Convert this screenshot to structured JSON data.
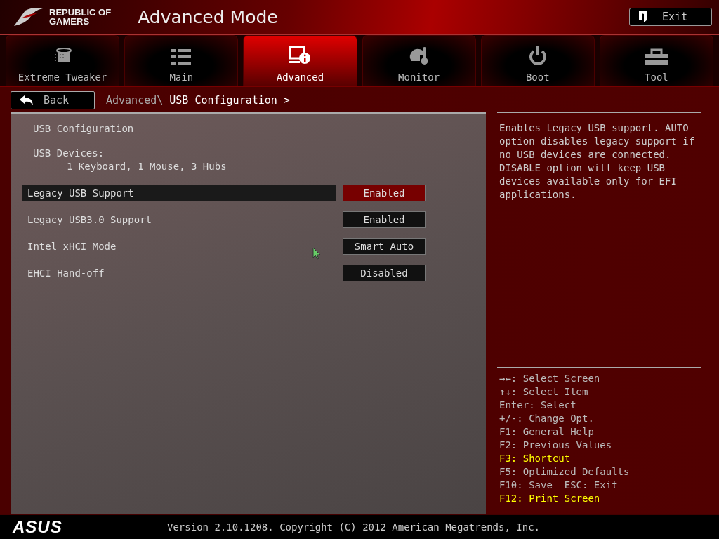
{
  "header": {
    "brand_line_1": "REPUBLIC OF",
    "brand_line_2": "GAMERS",
    "title": "Advanced Mode",
    "exit_button": "Exit"
  },
  "tabs": [
    {
      "label": "Extreme Tweaker",
      "selected": false
    },
    {
      "label": "Main",
      "selected": false
    },
    {
      "label": "Advanced",
      "selected": true
    },
    {
      "label": "Monitor",
      "selected": false
    },
    {
      "label": "Boot",
      "selected": false
    },
    {
      "label": "Tool",
      "selected": false
    }
  ],
  "back_button": "Back",
  "breadcrumb": {
    "parent": "Advanced\\",
    "current": "USB Configuration >"
  },
  "items": [
    {
      "kind": "heading",
      "label": "USB Configuration"
    },
    {
      "kind": "info",
      "label": "USB Devices:",
      "value": "1 Keyboard, 1 Mouse, 3 Hubs"
    },
    {
      "kind": "setting",
      "label": "Legacy USB Support",
      "value": "Enabled",
      "selected": true
    },
    {
      "kind": "setting",
      "label": "Legacy USB3.0 Support",
      "value": "Enabled",
      "selected": false
    },
    {
      "kind": "setting",
      "label": "Intel xHCI Mode",
      "value": "Smart Auto",
      "selected": false
    },
    {
      "kind": "setting",
      "label": "EHCI Hand-off",
      "value": "Disabled",
      "selected": false
    }
  ],
  "help_text": "Enables Legacy USB support. AUTO option disables legacy support if no USB devices are connected. DISABLE option will keep USB devices available only for EFI applications.",
  "key_help": [
    {
      "text": "→←: Select Screen",
      "highlight": false
    },
    {
      "text": "↑↓: Select Item",
      "highlight": false
    },
    {
      "text": "Enter: Select",
      "highlight": false
    },
    {
      "text": "+/-: Change Opt.",
      "highlight": false
    },
    {
      "text": "F1: General Help",
      "highlight": false
    },
    {
      "text": "F2: Previous Values",
      "highlight": false
    },
    {
      "text": "F3: Shortcut",
      "highlight": true
    },
    {
      "text": "F5: Optimized Defaults",
      "highlight": false
    },
    {
      "text": "F10: Save  ESC: Exit",
      "highlight": false
    },
    {
      "text": "F12: Print Screen",
      "highlight": true
    }
  ],
  "footer": {
    "logo": "ASUS",
    "version": "Version 2.10.1208. Copyright (C) 2012 American Megatrends, Inc."
  }
}
